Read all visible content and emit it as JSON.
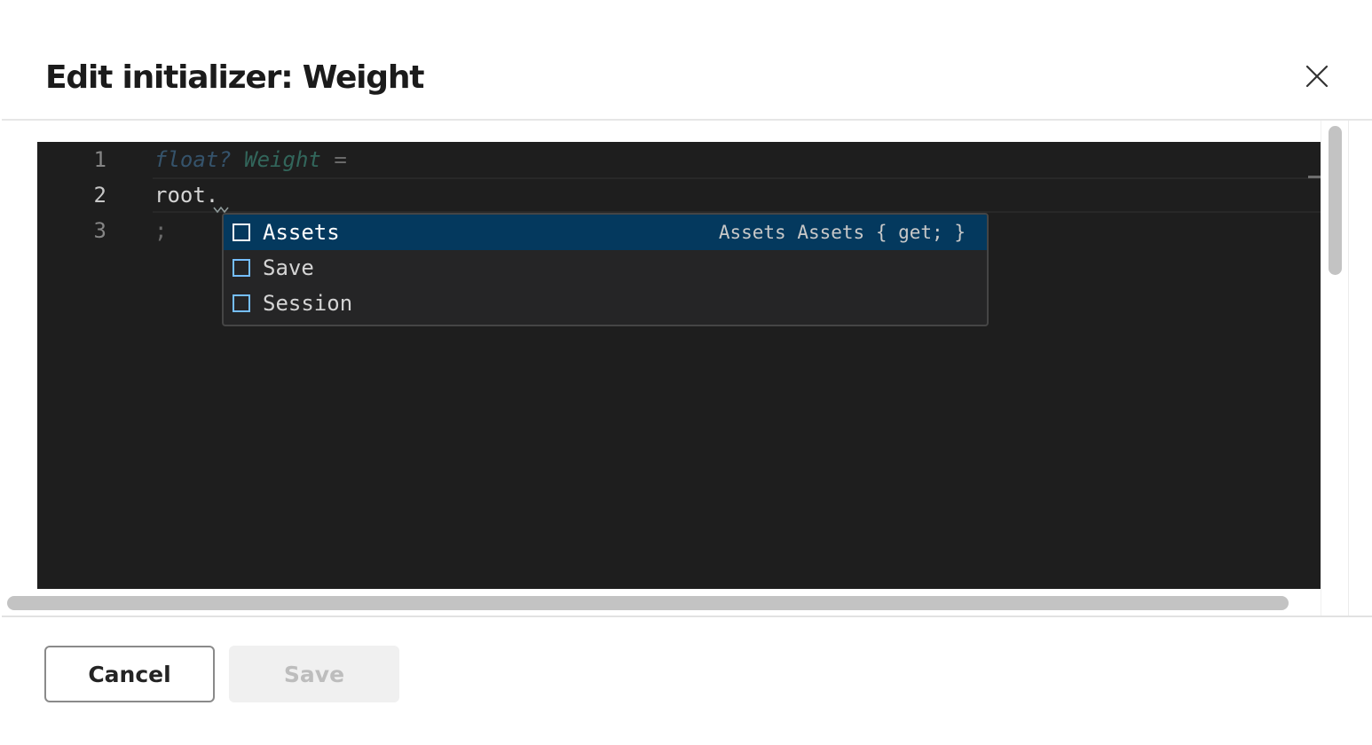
{
  "dialog": {
    "title": "Edit initializer: Weight",
    "close_icon": "close-icon"
  },
  "editor": {
    "line_numbers": [
      "1",
      "2",
      "3"
    ],
    "active_line": 2,
    "lines": {
      "line1": {
        "keyword": "float?",
        "identifier": "Weight",
        "operator": "="
      },
      "line2": {
        "text": "root."
      },
      "line3": {
        "text": ";"
      }
    },
    "colors": {
      "background": "#1e1e1e",
      "keyword": "#569cd6",
      "type": "#4ec9b0",
      "text": "#d4d4d4"
    }
  },
  "suggestions": {
    "selected_index": 0,
    "items": [
      {
        "label": "Assets",
        "detail": "Assets Assets { get; }",
        "icon": "property-icon"
      },
      {
        "label": "Save",
        "detail": "",
        "icon": "property-icon"
      },
      {
        "label": "Session",
        "detail": "",
        "icon": "property-icon"
      }
    ],
    "colors": {
      "selected_bg": "#04395e",
      "icon": "#75beff"
    }
  },
  "footer": {
    "cancel_label": "Cancel",
    "save_label": "Save",
    "save_disabled": true
  }
}
